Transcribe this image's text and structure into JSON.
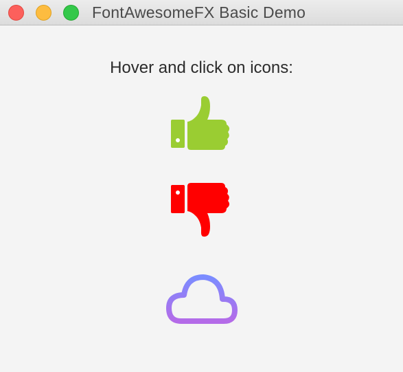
{
  "window": {
    "title": "FontAwesomeFX Basic Demo"
  },
  "main": {
    "instruction": "Hover and click on icons:"
  },
  "icons": [
    {
      "name": "thumbs-up-icon",
      "color": "#9acd32"
    },
    {
      "name": "thumbs-down-icon",
      "color": "#ff0000"
    },
    {
      "name": "cloud-icon",
      "color_start": "#7b8cff",
      "color_end": "#b46be8"
    }
  ]
}
